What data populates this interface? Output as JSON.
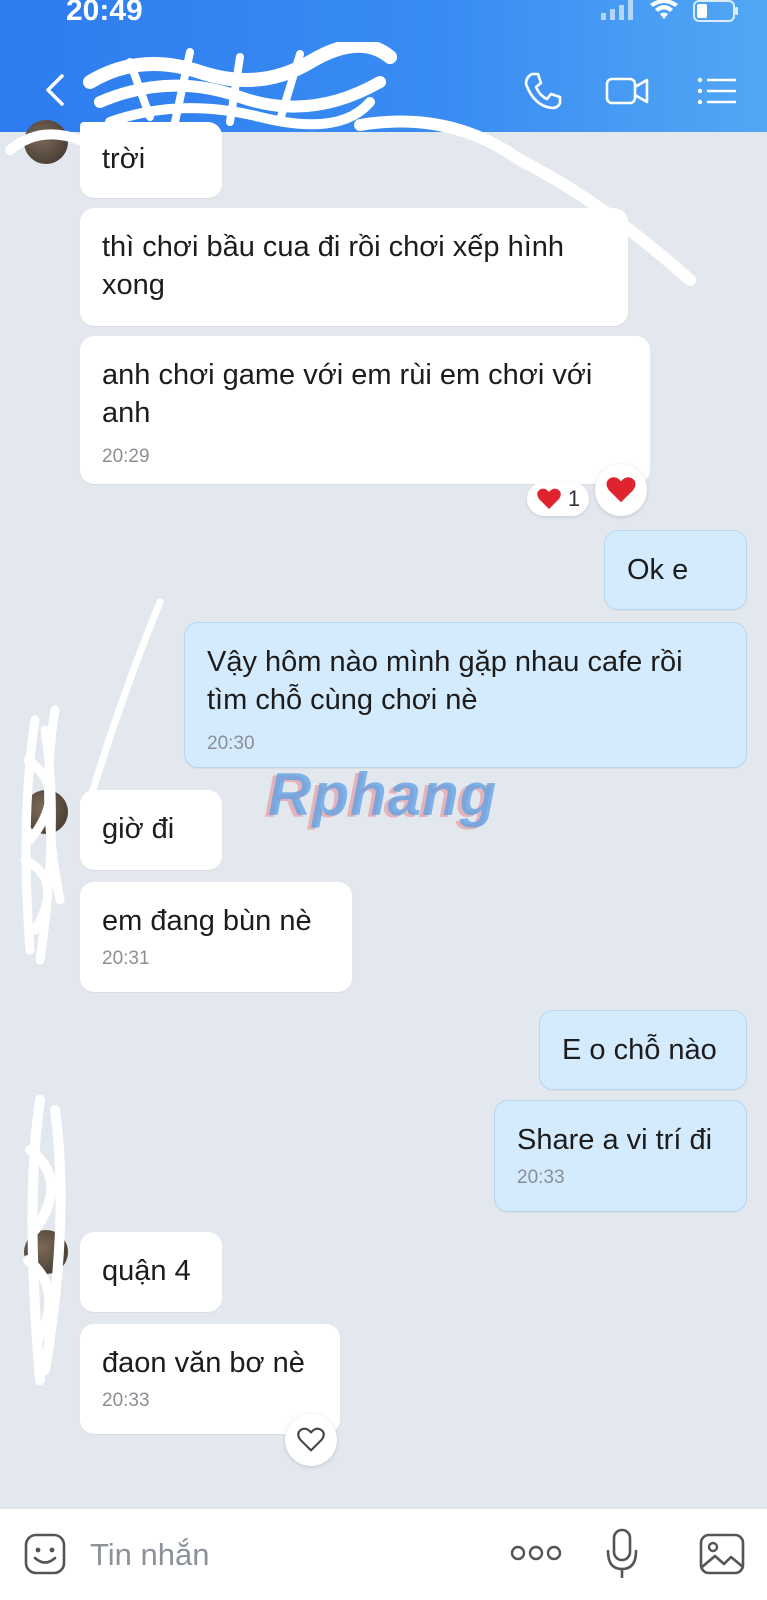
{
  "status_bar": {
    "time": "20:49"
  },
  "chat": {
    "messages": [
      {
        "text": "trời"
      },
      {
        "text": "thì chơi bầu cua đi rồi chơi xếp hình xong"
      },
      {
        "text": "anh chơi game với em rùi em chơi với anh",
        "time": "20:29",
        "reaction_count": "1"
      },
      {
        "text": "Ok e"
      },
      {
        "text": "Vậy hôm nào mình gặp nhau cafe rồi tìm chỗ cùng chơi nè",
        "time": "20:30"
      },
      {
        "text": "giờ đi"
      },
      {
        "text": "em đang bùn nè",
        "time": "20:31"
      },
      {
        "text": "E o chỗ nào"
      },
      {
        "text": "Share a vi trí đi",
        "time": "20:33"
      },
      {
        "text": "quận 4"
      },
      {
        "text": "đaon văn bơ nè",
        "time": "20:33"
      }
    ]
  },
  "watermark": "Rphang",
  "composer": {
    "placeholder": "Tin nhắn"
  },
  "colors": {
    "header": "#2d7cf0",
    "incoming_bubble": "#ffffff",
    "outgoing_bubble": "#d4ebfd",
    "background": "#e3e8ef"
  },
  "icons": [
    "back-icon",
    "phone-icon",
    "video-call-icon",
    "menu-icon",
    "heart-icon",
    "sticker-icon",
    "more-icon",
    "microphone-icon",
    "image-icon"
  ]
}
